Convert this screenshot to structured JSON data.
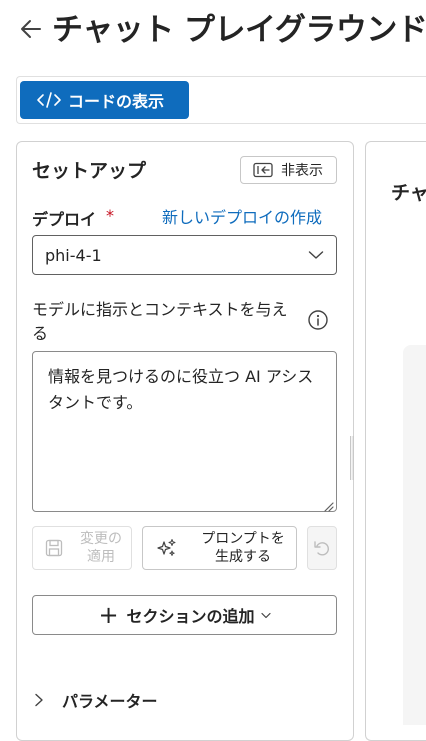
{
  "header": {
    "title": "チャット プレイグラウンド"
  },
  "toolbar": {
    "view_code_label": "コードの表示"
  },
  "setup": {
    "title": "セットアップ",
    "hide_label": "非表示",
    "deployment_label": "デプロイ",
    "required_mark": "*",
    "new_deployment_link": "新しいデプロイの作成",
    "deployment_value": "phi-4-1",
    "instructions_label": "モデルに指示とコンテキストを与える",
    "instructions_value": "情報を見つけるのに役立つ AI アシスタントです。",
    "apply_label": "変更の適用",
    "generate_prompt_label": "プロンプトを生成する",
    "add_section_label": "セクションの追加",
    "parameters_label": "パラメーター"
  },
  "chat": {
    "title_partial": "チャ"
  },
  "colors": {
    "accent": "#0f6cbd",
    "required": "#c50f1f",
    "panel_border": "#d1d1d1"
  }
}
